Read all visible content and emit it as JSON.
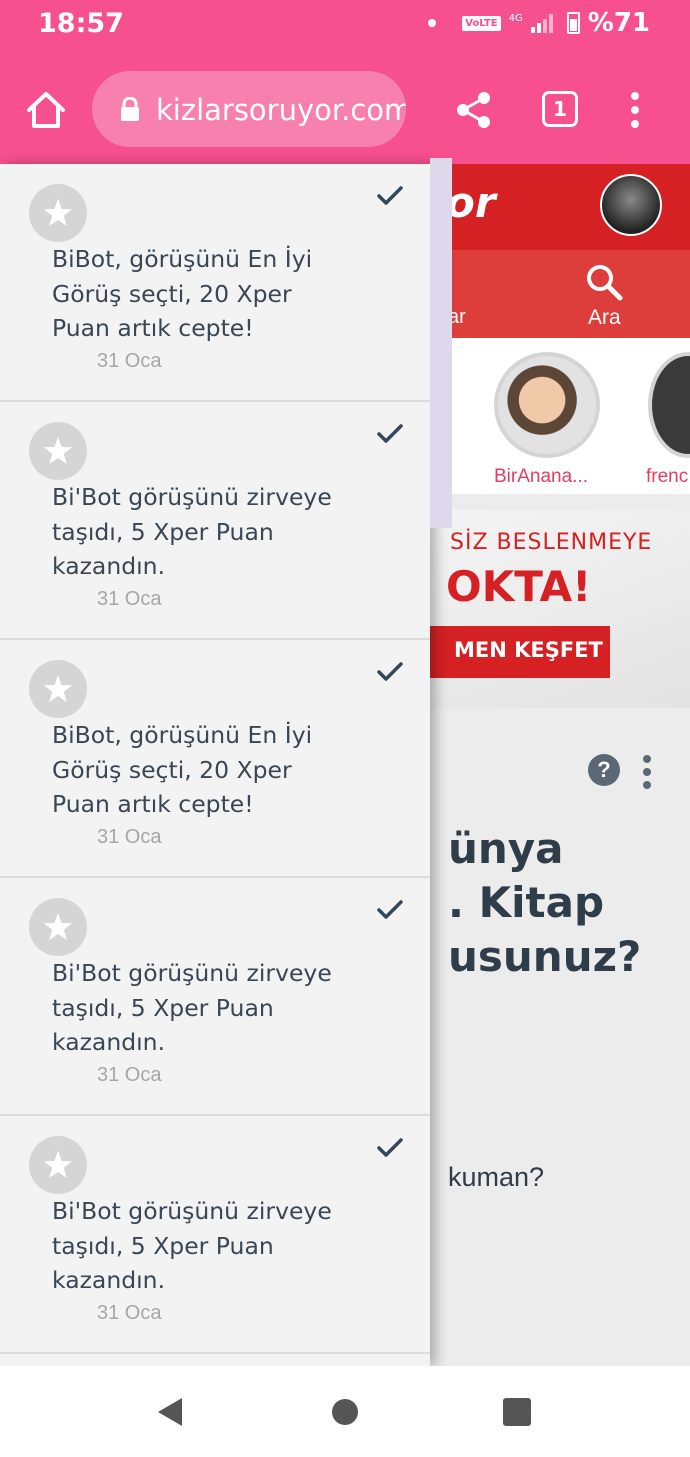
{
  "status_bar": {
    "time": "18:57",
    "volte": "VoLTE",
    "network": "4G",
    "battery": "%71"
  },
  "browser": {
    "url": "kizlarsoruyor.com",
    "tab_count": "1",
    "icons": [
      "home-icon",
      "lock-icon",
      "share-icon",
      "tab-switcher-icon",
      "more-vert-icon"
    ]
  },
  "background_page": {
    "logo": "or",
    "nav_items": [
      {
        "label": "ar"
      },
      {
        "label": "Ara",
        "icon": "search-icon"
      }
    ],
    "stories": [
      {
        "label": "BirAnana..."
      },
      {
        "label": "frenc"
      }
    ],
    "ad": {
      "line1": "SİZ BESLENMEYE",
      "line2": "OKTA!",
      "button": "MEN KEŞFET"
    },
    "help_label": "?",
    "title": "ünya\n. Kitap\nusunuz?",
    "subtitle": "kuman?"
  },
  "notifications": [
    {
      "text": "BiBot, görüşünü En İyi Görüş seçti, 20 Xper Puan artık cepte!",
      "date": "31 Oca",
      "read": true
    },
    {
      "text": "Bi'Bot görüşünü zirveye taşıdı, 5 Xper Puan kazandın.",
      "date": "31 Oca",
      "read": true
    },
    {
      "text": "BiBot, görüşünü En İyi Görüş seçti, 20 Xper Puan artık cepte!",
      "date": "31 Oca",
      "read": true
    },
    {
      "text": "Bi'Bot görüşünü zirveye taşıdı, 5 Xper Puan kazandın.",
      "date": "31 Oca",
      "read": true
    },
    {
      "text": "Bi'Bot görüşünü zirveye taşıdı, 5 Xper Puan kazandın.",
      "date": "31 Oca",
      "read": true
    }
  ],
  "colors": {
    "browser_bar": "#f6508f",
    "site_header": "#d52124",
    "drawer_bg": "#f3f3f3",
    "notif_text": "#394655",
    "date_text": "#a6a6a6"
  }
}
